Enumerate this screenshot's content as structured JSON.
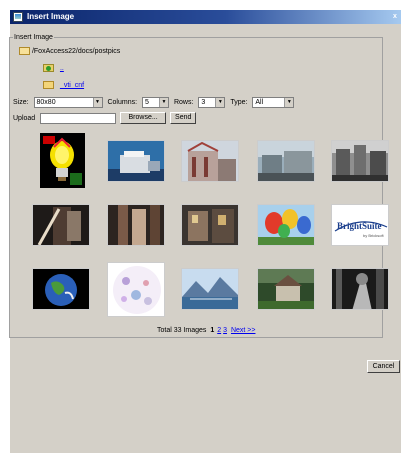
{
  "window": {
    "title": "Insert Image",
    "close_glyph": "x"
  },
  "group": {
    "legend": "Insert Image"
  },
  "browser": {
    "current_path": "/FoxAccess22/docs/postpics",
    "up_link": "..",
    "folder_link": "_vti_cnf"
  },
  "controls": {
    "size_label": "Size:",
    "size_value": "80x80",
    "columns_label": "Columns:",
    "columns_value": "5",
    "rows_label": "Rows:",
    "rows_value": "3",
    "type_label": "Type:",
    "type_value": "All"
  },
  "upload": {
    "label": "Upload",
    "browse_label": "Browse...",
    "send_label": "Send"
  },
  "thumbnails": [
    {
      "name": "lightbulb"
    },
    {
      "name": "printer"
    },
    {
      "name": "industrial-building"
    },
    {
      "name": "cityscape"
    },
    {
      "name": "street-scene"
    },
    {
      "name": "interior-doorway"
    },
    {
      "name": "hallway-interior"
    },
    {
      "name": "building-interior"
    },
    {
      "name": "hot-air-balloons"
    },
    {
      "name": "brightsuite-logo"
    },
    {
      "name": "earth"
    },
    {
      "name": "floral-pattern"
    },
    {
      "name": "mountain-lake"
    },
    {
      "name": "cottage"
    },
    {
      "name": "forest-path"
    }
  ],
  "brightsuite": {
    "text": "BrightSuite",
    "tagline": "by Bricksoft"
  },
  "pagination": {
    "total_text": "Total 33 Images",
    "current_page": "1",
    "pages": [
      "2",
      "3"
    ],
    "next_label": "Next >>"
  },
  "footer": {
    "cancel_label": "Cancel"
  },
  "colors": {
    "titlebar": "#0a246a",
    "dialog_bg": "#d4d0c8",
    "link": "#0000ee",
    "logo_blue": "#1a3e8c"
  }
}
